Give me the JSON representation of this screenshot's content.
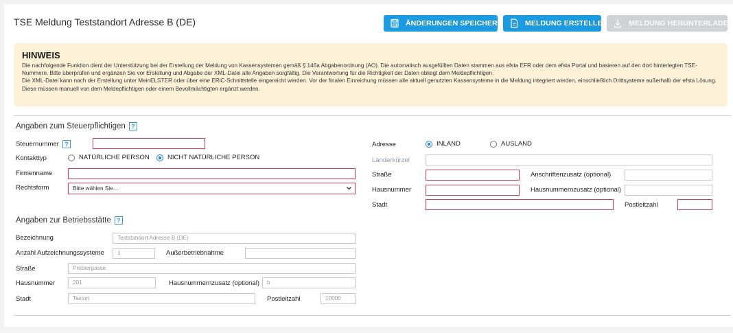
{
  "header": {
    "title": "TSE Meldung Teststandort Adresse B (DE)",
    "save_label": "ÄNDERUNGEN SPEICHERN",
    "create_label": "MELDUNG ERSTELLEN",
    "download_label": "MELDUNG HERUNTERLADEN"
  },
  "hint": {
    "title": "HINWEIS",
    "line1": "Die nachfolgende Funktion dient der Unterstützung bei der Erstellung der Meldung von Kassensystemen gemäß § 146a Abgabenordnung (AO). Die automatisch ausgefüllten Daten stammen aus efsta EFR oder dem efsta Portal und basieren auf den dort hinterlegten TSE-Nummern. Bitte überprüfen und ergänzen Sie vor Erstellung und Abgabe der XML-Datei alle Angaben sorgfältig. Die Verantwortung für die Richtigkeit der Daten obliegt dem Meldepflichtigen.",
    "line2": "Die XML-Datei kann nach der Erstellung unter MeinELSTER oder über eine ERiC-Schnittstelle eingereicht werden. Vor der finalen Einreichung müssen alle aktuell genutzten Kassensysteme in die Meldung integriert werden, einschließlich Drittsysteme außerhalb der efsta Lösung. Diese müssen manuell von dem Meldepflichtigen oder einem Bevollmächtigten ergänzt werden."
  },
  "taxpayer": {
    "section_title": "Angaben zum Steuerpflichtigen",
    "help": "?",
    "steuernummer_label": "Steuernummer",
    "steuernummer_value": "",
    "kontakttyp_label": "Kontakttyp",
    "kontakttyp_options": [
      "NATÜRLICHE PERSON",
      "NICHT NATÜRLICHE PERSON"
    ],
    "kontakttyp_selected": "NICHT NATÜRLICHE PERSON",
    "firmenname_label": "Firmenname",
    "firmenname_value": "",
    "rechtsform_label": "Rechtsform",
    "rechtsform_value": "Bitte wählen Sie...",
    "adresse_label": "Adresse",
    "adresse_options": [
      "INLAND",
      "AUSLAND"
    ],
    "adresse_selected": "INLAND",
    "laenderkuerzel_label": "Länderkürzel",
    "strasse_label": "Straße",
    "anschriftenzusatz_label": "Anschriftenzusatz (optional)",
    "hausnummer_label": "Hausnummer",
    "hausnummernzusatz_label": "Hausnummernzusatz (optional)",
    "stadt_label": "Stadt",
    "plz_label": "Postleitzahl"
  },
  "site": {
    "section_title": "Angaben zur Betriebsstätte",
    "help": "?",
    "bezeichnung_label": "Bezeichnung",
    "bezeichnung_value": "Teststandort Adresse B (DE)",
    "anzahl_label": "Anzahl Aufzeichnungssysteme",
    "anzahl_value": "1",
    "ausserbetrieb_label": "Außerbetriebnahme",
    "ausserbetrieb_value": "",
    "strasse_label": "Straße",
    "strasse_value": "Probiergasse",
    "hausnummer_label": "Hausnummer",
    "hausnummer_value": "201",
    "hausnummernzusatz_label": "Hausnummernzusatz (optional)",
    "hausnummernzusatz_value": "b",
    "stadt_label": "Stadt",
    "stadt_value": "Testort",
    "plz_label": "Postleitzahl",
    "plz_value": "10000"
  },
  "icons": {
    "save": "floppy-disk-icon",
    "create": "document-icon",
    "download": "download-icon",
    "dropdown": "chevron-down-icon"
  },
  "colors": {
    "primary": "#1d9be0",
    "disabled": "#cfd3d6",
    "required_border": "#d83a5a",
    "hint_bg": "#fdf2d7"
  }
}
